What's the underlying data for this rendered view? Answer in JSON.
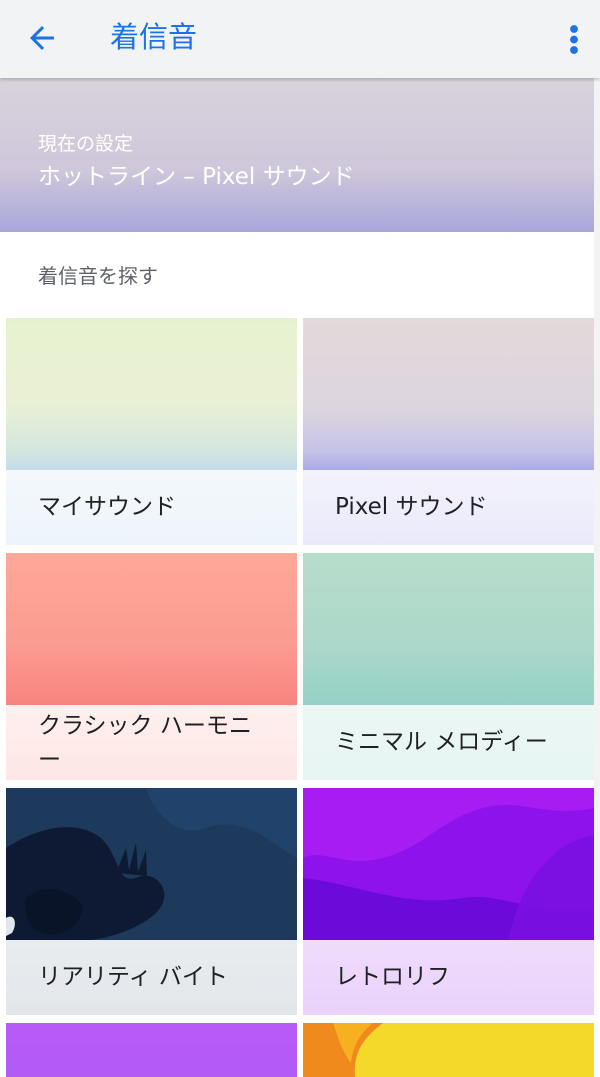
{
  "appbar": {
    "title": "着信音",
    "back_icon": "arrow-back-icon",
    "more_icon": "more-vert-icon",
    "accent": "#1a73e8"
  },
  "current_setting": {
    "label": "現在の設定",
    "value": "ホットライン – Pixel サウンド"
  },
  "section_title": "着信音を探す",
  "categories": [
    {
      "label_line1": "マイサウンド",
      "label_line2": ""
    },
    {
      "label_line1": "Pixel サウンド",
      "label_line2": ""
    },
    {
      "label_line1": "クラシック ハーモニ",
      "label_line2": "ー"
    },
    {
      "label_line1": "ミニマル メロディー",
      "label_line2": ""
    },
    {
      "label_line1": "リアリティ バイト",
      "label_line2": ""
    },
    {
      "label_line1": "レトロリフ",
      "label_line2": ""
    }
  ]
}
